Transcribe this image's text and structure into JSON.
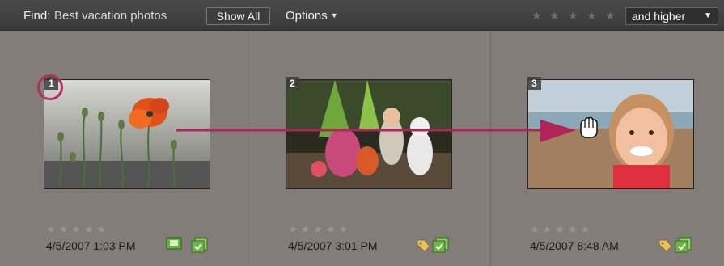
{
  "toolbar": {
    "find_label": "Find:",
    "find_value": "Best vacation photos",
    "show_all_label": "Show All",
    "options_label": "Options",
    "rating_filter": "and higher"
  },
  "photos": [
    {
      "number": "1",
      "date": "4/5/2007 1:03 PM",
      "subject": "orange poppy flowers"
    },
    {
      "number": "2",
      "date": "4/5/2007 3:01 PM",
      "subject": "children with costumed characters"
    },
    {
      "number": "3",
      "date": "4/5/2007 8:48 AM",
      "subject": "smiling girl"
    }
  ],
  "colors": {
    "highlight": "#b03060",
    "arrow": "#b0245a",
    "background": "#837d79"
  }
}
